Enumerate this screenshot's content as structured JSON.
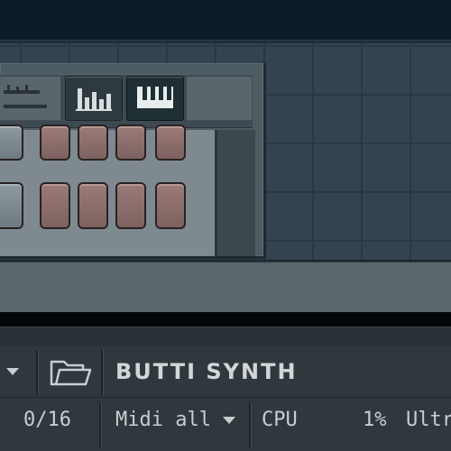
{
  "toolbar": {
    "icons": [
      "slider-icon",
      "equalizer-icon",
      "piano-keys-icon"
    ]
  },
  "status": {
    "plugin_name": "BUTTI SYNTH",
    "voices": "0/16",
    "midi_label": "Midi all",
    "cpu_label": "CPU",
    "cpu_value": "1%",
    "quality_label": "Ultr"
  },
  "colors": {
    "workspace": "#34434f",
    "step_button": "#8a6e6c",
    "status_bg": "#2f383d",
    "text": "#c8cdcf"
  }
}
